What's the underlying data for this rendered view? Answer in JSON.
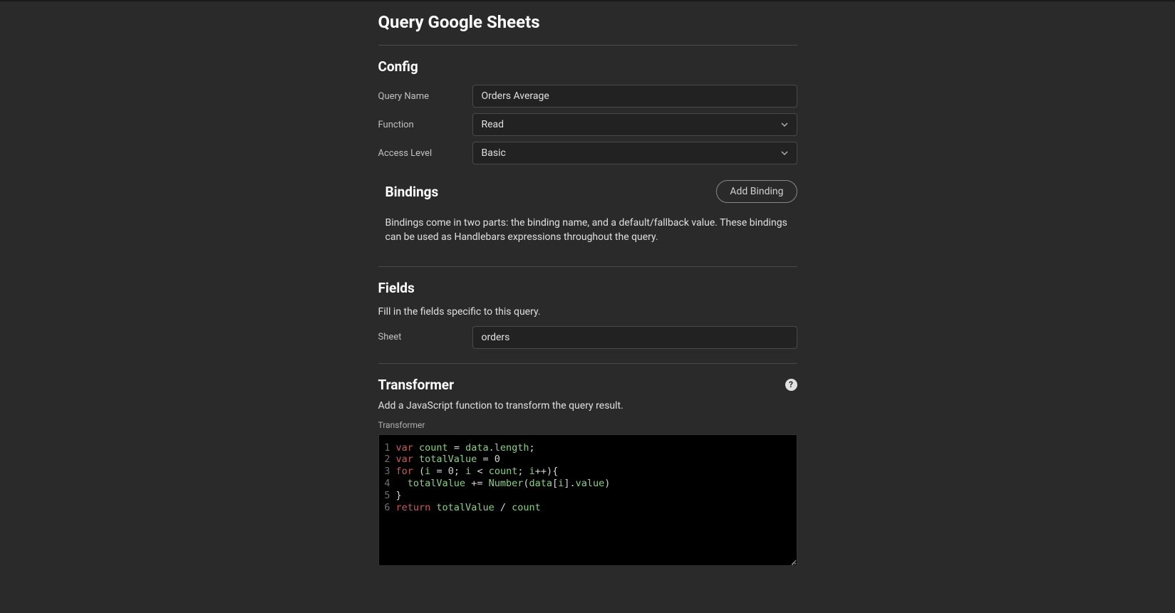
{
  "page": {
    "title": "Query Google Sheets"
  },
  "config": {
    "heading": "Config",
    "queryName": {
      "label": "Query Name",
      "value": "Orders Average"
    },
    "function": {
      "label": "Function",
      "value": "Read"
    },
    "accessLevel": {
      "label": "Access Level",
      "value": "Basic"
    }
  },
  "bindings": {
    "heading": "Bindings",
    "addButton": "Add Binding",
    "description": "Bindings come in two parts: the binding name, and a default/fallback value. These bindings can be used as Handlebars expressions throughout the query."
  },
  "fields": {
    "heading": "Fields",
    "description": "Fill in the fields specific to this query.",
    "sheet": {
      "label": "Sheet",
      "value": "orders"
    }
  },
  "transformer": {
    "heading": "Transformer",
    "helpGlyph": "?",
    "description": "Add a JavaScript function to transform the query result.",
    "label": "Transformer",
    "code": {
      "lines": [
        {
          "n": "1",
          "tokens": [
            [
              "kw",
              "var"
            ],
            [
              "sp",
              " "
            ],
            [
              "var",
              "count"
            ],
            [
              "sp",
              " "
            ],
            [
              "op",
              "="
            ],
            [
              "sp",
              " "
            ],
            [
              "var",
              "data"
            ],
            [
              "dot",
              "."
            ],
            [
              "prop",
              "length"
            ],
            [
              "punc",
              ";"
            ]
          ]
        },
        {
          "n": "2",
          "tokens": [
            [
              "kw",
              "var"
            ],
            [
              "sp",
              " "
            ],
            [
              "var",
              "totalValue"
            ],
            [
              "sp",
              " "
            ],
            [
              "op",
              "="
            ],
            [
              "sp",
              " "
            ],
            [
              "num",
              "0"
            ]
          ]
        },
        {
          "n": "3",
          "tokens": [
            [
              "kw",
              "for"
            ],
            [
              "sp",
              " "
            ],
            [
              "punc",
              "("
            ],
            [
              "var",
              "i"
            ],
            [
              "sp",
              " "
            ],
            [
              "op",
              "="
            ],
            [
              "sp",
              " "
            ],
            [
              "num",
              "0"
            ],
            [
              "punc",
              ";"
            ],
            [
              "sp",
              " "
            ],
            [
              "var",
              "i"
            ],
            [
              "sp",
              " "
            ],
            [
              "op",
              "<"
            ],
            [
              "sp",
              " "
            ],
            [
              "var",
              "count"
            ],
            [
              "punc",
              ";"
            ],
            [
              "sp",
              " "
            ],
            [
              "var",
              "i"
            ],
            [
              "op",
              "++"
            ],
            [
              "punc",
              ")"
            ],
            [
              "punc",
              "{"
            ]
          ]
        },
        {
          "n": "4",
          "tokens": [
            [
              "sp",
              "  "
            ],
            [
              "var",
              "totalValue"
            ],
            [
              "sp",
              " "
            ],
            [
              "op",
              "+="
            ],
            [
              "sp",
              " "
            ],
            [
              "fn",
              "Number"
            ],
            [
              "punc",
              "("
            ],
            [
              "var",
              "data"
            ],
            [
              "punc",
              "["
            ],
            [
              "var",
              "i"
            ],
            [
              "punc",
              "]"
            ],
            [
              "dot",
              "."
            ],
            [
              "prop",
              "value"
            ],
            [
              "punc",
              ")"
            ]
          ]
        },
        {
          "n": "5",
          "tokens": [
            [
              "punc",
              "}"
            ]
          ]
        },
        {
          "n": "6",
          "tokens": [
            [
              "kw",
              "return"
            ],
            [
              "sp",
              " "
            ],
            [
              "var",
              "totalValue"
            ],
            [
              "sp",
              " "
            ],
            [
              "op",
              "/"
            ],
            [
              "sp",
              " "
            ],
            [
              "var",
              "count"
            ]
          ]
        }
      ]
    }
  }
}
